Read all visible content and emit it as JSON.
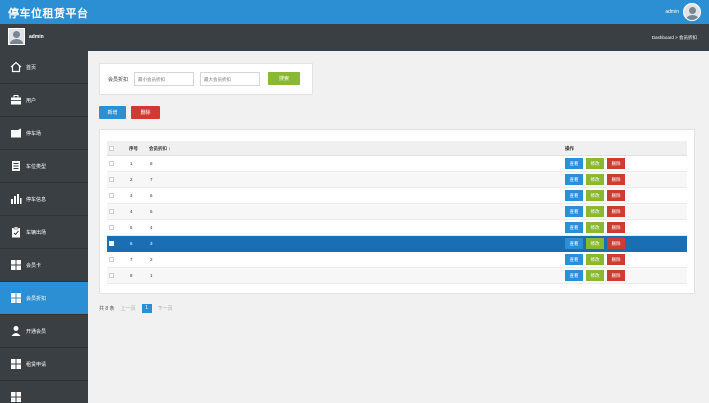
{
  "app": {
    "title": "停车位租赁平台"
  },
  "top_user": {
    "name": "admin"
  },
  "sub_user": {
    "name": "admin"
  },
  "breadcrumb": "Dashboard > 会员折扣",
  "sidebar": {
    "items": [
      {
        "label": "首页",
        "icon": "home-icon"
      },
      {
        "label": "用户",
        "icon": "briefcase-icon"
      },
      {
        "label": "停车场",
        "icon": "building-icon"
      },
      {
        "label": "车位类型",
        "icon": "document-icon"
      },
      {
        "label": "停车信息",
        "icon": "bar-chart-icon"
      },
      {
        "label": "车辆出场",
        "icon": "clipboard-icon"
      },
      {
        "label": "会员卡",
        "icon": "grid-icon"
      },
      {
        "label": "会员折扣",
        "icon": "grid-icon",
        "active": true
      },
      {
        "label": "开通会员",
        "icon": "user-icon"
      },
      {
        "label": "租赁申请",
        "icon": "grid-icon"
      }
    ]
  },
  "search": {
    "label": "会员折扣",
    "min_placeholder": "最小会员折扣",
    "max_placeholder": "最大会员折扣",
    "button": "搜索"
  },
  "toolbar": {
    "add": "新增",
    "delete": "删除"
  },
  "table": {
    "headers": {
      "seq": "序号",
      "discount": "会员折扣 ↕",
      "ops": "操作"
    },
    "rows": [
      {
        "seq": "1",
        "discount": "8"
      },
      {
        "seq": "2",
        "discount": "7"
      },
      {
        "seq": "3",
        "discount": "6"
      },
      {
        "seq": "4",
        "discount": "5"
      },
      {
        "seq": "5",
        "discount": "4"
      },
      {
        "seq": "6",
        "discount": "3",
        "selected": true
      },
      {
        "seq": "7",
        "discount": "2"
      },
      {
        "seq": "8",
        "discount": "1"
      }
    ],
    "actions": {
      "view": "查看",
      "edit": "修改",
      "delete": "删除"
    }
  },
  "pager": {
    "total": "共 8 条",
    "prev": "上一页",
    "current": "1",
    "next": "下一页"
  },
  "colors": {
    "primary": "#2d8fd3",
    "sidebar": "#3a3f44",
    "green": "#8ab833",
    "red": "#cf3b30",
    "selected_row": "#1a6fb4"
  }
}
